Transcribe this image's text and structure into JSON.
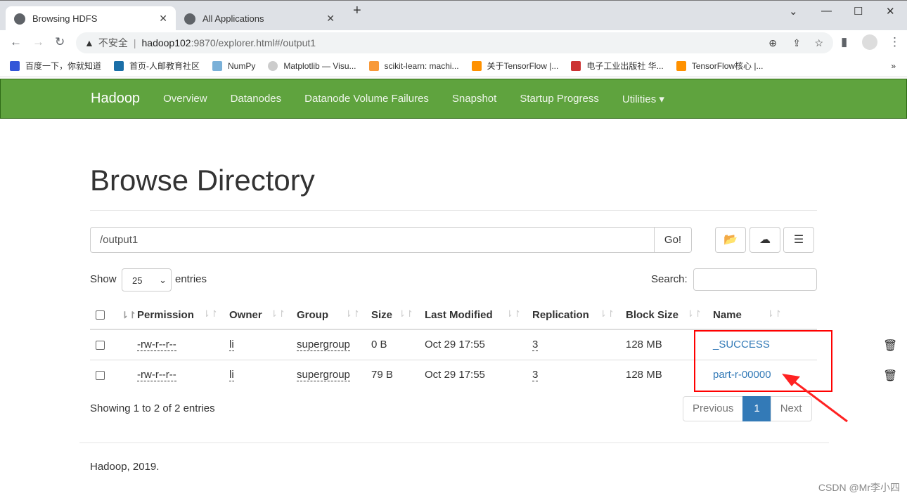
{
  "browser": {
    "tabs": [
      {
        "title": "Browsing HDFS"
      },
      {
        "title": "All Applications"
      }
    ],
    "security": "不安全",
    "url_host": "hadoop102",
    "url_rest": ":9870/explorer.html#/output1",
    "bookmarks": [
      "百度一下，你就知道",
      "首页-人邮教育社区",
      "NumPy",
      "Matplotlib — Visu...",
      "scikit-learn: machi...",
      "关于TensorFlow |...",
      "电子工业出版社 华...",
      "TensorFlow核心 |..."
    ]
  },
  "navbar": {
    "brand": "Hadoop",
    "items": [
      "Overview",
      "Datanodes",
      "Datanode Volume Failures",
      "Snapshot",
      "Startup Progress",
      "Utilities ▾"
    ],
    "color": "#5fa33e"
  },
  "page": {
    "title": "Browse Directory",
    "path": "/output1",
    "go": "Go!",
    "show": "Show",
    "page_size": "25",
    "entries": "entries",
    "search_label": "Search:"
  },
  "table": {
    "headers": [
      "Permission",
      "Owner",
      "Group",
      "Size",
      "Last Modified",
      "Replication",
      "Block Size",
      "Name"
    ],
    "rows": [
      {
        "permission": "-rw-r--r--",
        "owner": "li",
        "group": "supergroup",
        "size": "0 B",
        "modified": "Oct 29 17:55",
        "replication": "3",
        "block_size": "128 MB",
        "name": "_SUCCESS"
      },
      {
        "permission": "-rw-r--r--",
        "owner": "li",
        "group": "supergroup",
        "size": "79 B",
        "modified": "Oct 29 17:55",
        "replication": "3",
        "block_size": "128 MB",
        "name": "part-r-00000"
      }
    ]
  },
  "footer_info": "Showing 1 to 2 of 2 entries",
  "pagination": {
    "previous": "Previous",
    "current": "1",
    "next": "Next"
  },
  "footer": "Hadoop, 2019.",
  "watermark": "CSDN @Mr李小四"
}
